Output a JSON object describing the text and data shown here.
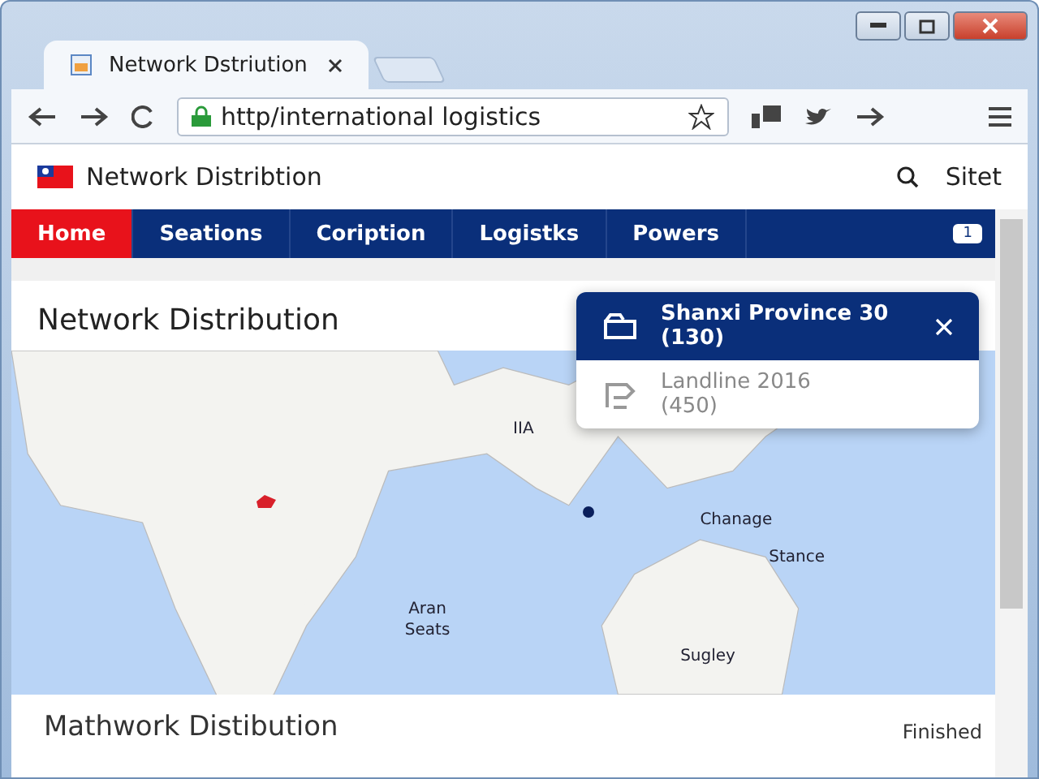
{
  "browser": {
    "tab_title": "Network Dstriution",
    "address": "http/international logistics"
  },
  "site": {
    "title": "Network Distribtion",
    "search_label": "Sitet"
  },
  "nav": [
    {
      "label": "Home",
      "selected": true
    },
    {
      "label": "Seations",
      "selected": false
    },
    {
      "label": "Coription",
      "selected": false
    },
    {
      "label": "Logistks",
      "selected": false
    },
    {
      "label": "Powers",
      "selected": false
    }
  ],
  "nav_badge": "1",
  "section": {
    "title": "Network Distribution"
  },
  "map_labels": [
    {
      "text": "IIA"
    },
    {
      "text": "Chanage"
    },
    {
      "text": "Stance"
    },
    {
      "text": "Aran\nSeats"
    },
    {
      "text": "Sugley"
    }
  ],
  "popup": {
    "items": [
      {
        "kind": "folder",
        "title": "Shanxi Province 30",
        "count": "(130)",
        "selected": true
      },
      {
        "kind": "route",
        "title": "Landline 2016",
        "count": "(450)",
        "selected": false
      }
    ]
  },
  "footer": {
    "title": "Mathwork Distibution",
    "status": "Finished"
  }
}
